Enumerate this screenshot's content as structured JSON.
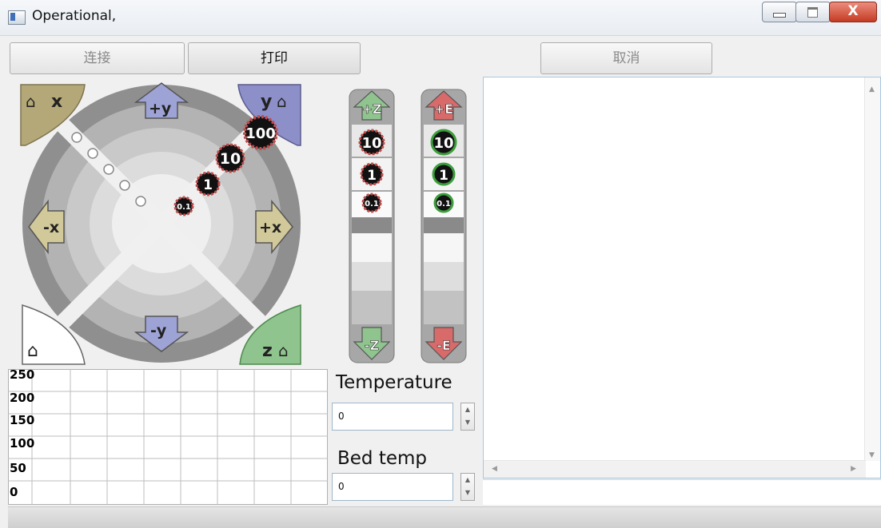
{
  "window": {
    "title": "Operational,",
    "close_glyph": "X"
  },
  "toolbar": {
    "connect_label": "连接",
    "print_label": "打印",
    "cancel_label": "取消"
  },
  "xy_jog": {
    "home_x": "x",
    "home_y": "y",
    "home_z": "z",
    "plus_y": "+y",
    "minus_y": "-y",
    "plus_x": "+x",
    "minus_x": "-x",
    "steps": [
      "100",
      "10",
      "1",
      "0.1"
    ]
  },
  "z_jog": {
    "up": "+Z",
    "down": "-Z",
    "steps": [
      "10",
      "1",
      "0.1"
    ]
  },
  "e_jog": {
    "up": "+E",
    "down": "-E",
    "steps": [
      "10",
      "1",
      "0.1"
    ]
  },
  "temp_chart": {
    "y_labels": [
      "250",
      "200",
      "150",
      "100",
      "50",
      "0"
    ]
  },
  "temperature": {
    "label": "Temperature",
    "value": "0"
  },
  "bed_temp": {
    "label": "Bed temp",
    "value": "0"
  },
  "colors": {
    "x_home": "#b5a878",
    "y_home": "#8d8fc8",
    "z_home": "#8fc48f",
    "step_ring_red": "#c24b4b",
    "step_ring_green": "#3d9e3d"
  }
}
